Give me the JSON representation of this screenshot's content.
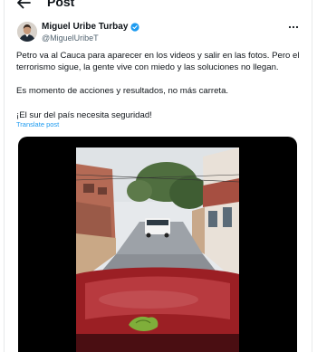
{
  "header": {
    "title": "Post"
  },
  "tweet": {
    "author_name": "Miguel Uribe Turbay",
    "author_handle": "@MiguelUribeT",
    "paragraphs": [
      "Petro va al Cauca para aparecer en los videos y salir en las fotos. Pero el terrorismo sigue, la gente vive con miedo y las soluciones no llegan.",
      "Es momento de acciones y resultados, no más carreta.",
      "¡El sur del país necesita seguridad!"
    ],
    "translate_label": "Translate post"
  },
  "colors": {
    "text": "#0f1419",
    "secondary": "#536471",
    "link": "#1d9bf0",
    "verified": "#1d9bf0",
    "media_bg": "#000000"
  },
  "icons": {
    "back": "arrow-left-icon",
    "verified": "verified-badge-icon",
    "more": "more-dots-icon"
  }
}
